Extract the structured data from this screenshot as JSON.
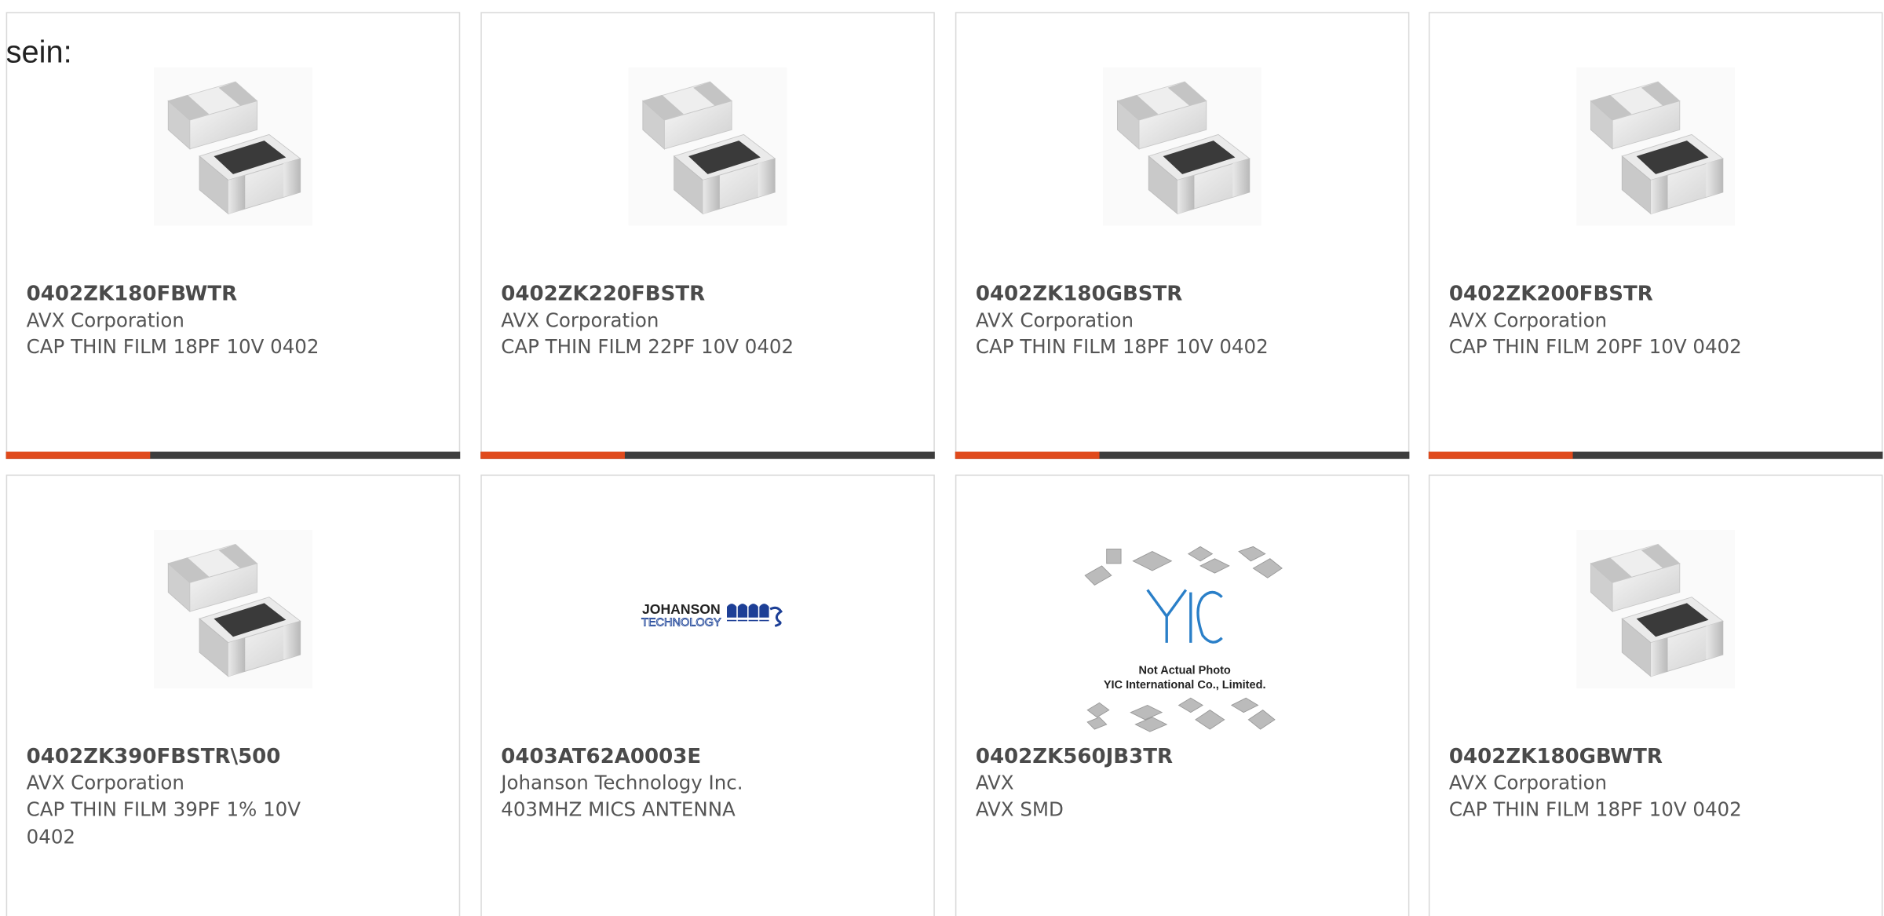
{
  "header_text": "sein:",
  "products": [
    {
      "part_number": "0402ZK180FBWTR",
      "manufacturer": "AVX Corporation",
      "description": "CAP THIN FILM 18PF 10V 0402",
      "image": "chip-capacitor"
    },
    {
      "part_number": "0402ZK220FBSTR",
      "manufacturer": "AVX Corporation",
      "description": "CAP THIN FILM 22PF 10V 0402",
      "image": "chip-capacitor"
    },
    {
      "part_number": "0402ZK180GBSTR",
      "manufacturer": "AVX Corporation",
      "description": "CAP THIN FILM 18PF 10V 0402",
      "image": "chip-capacitor"
    },
    {
      "part_number": "0402ZK200FBSTR",
      "manufacturer": "AVX Corporation",
      "description": "CAP THIN FILM 20PF 10V 0402",
      "image": "chip-capacitor"
    },
    {
      "part_number": "0402ZK390FBSTR\\500",
      "manufacturer": "AVX Corporation",
      "description": "CAP THIN FILM 39PF 1% 10V 0402",
      "image": "chip-capacitor"
    },
    {
      "part_number": "0403AT62A0003E",
      "manufacturer": "Johanson Technology Inc.",
      "description": "403MHZ MICS ANTENNA",
      "image": "johanson-logo"
    },
    {
      "part_number": "0402ZK560JB3TR",
      "manufacturer": "AVX",
      "description": "AVX SMD",
      "image": "yic-placeholder"
    },
    {
      "part_number": "0402ZK180GBWTR",
      "manufacturer": "AVX Corporation",
      "description": "CAP THIN FILM 18PF 10V 0402",
      "image": "chip-capacitor"
    }
  ],
  "johanson_logo": {
    "line1": "JOHANSON",
    "line2": "TECHNOLOGY"
  },
  "yic_image": {
    "logo": "YIC",
    "line1": "Not Actual Photo",
    "line2": "YIC International Co., Limited."
  },
  "colors": {
    "accent": "#e04a1c",
    "bar": "#3d3d3d",
    "border": "#d9d9d9"
  }
}
